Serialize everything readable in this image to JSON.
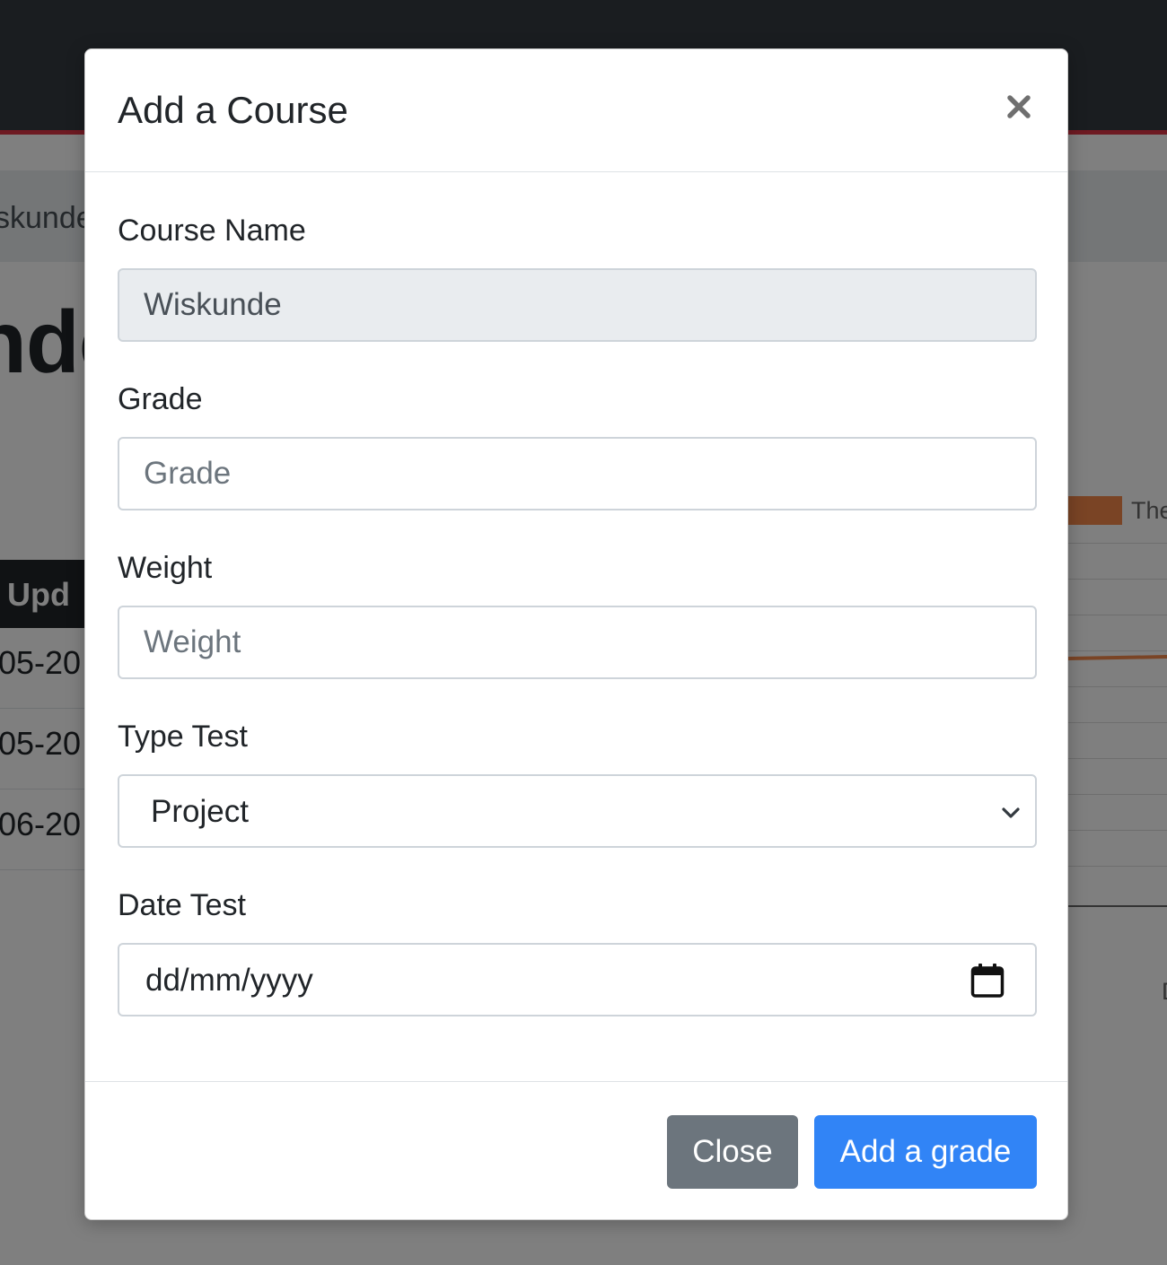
{
  "background": {
    "breadcrumb_fragment": "skunde",
    "heading_fragment": "nde",
    "table_header_fragment": "t Upd",
    "table_rows": [
      "05-20",
      "05-20",
      "06-20"
    ],
    "chart_legend_fragment": "The",
    "chart_axis_fragment": "D"
  },
  "modal": {
    "title": "Add a Course",
    "close_symbol": "×",
    "fields": {
      "course_name": {
        "label": "Course Name",
        "value": "Wiskunde"
      },
      "grade": {
        "label": "Grade",
        "placeholder": "Grade",
        "value": ""
      },
      "weight": {
        "label": "Weight",
        "placeholder": "Weight",
        "value": ""
      },
      "type_test": {
        "label": "Type Test",
        "selected": "Project"
      },
      "date_test": {
        "label": "Date Test",
        "placeholder": "dd/mm/yyyy"
      }
    },
    "footer": {
      "close_label": "Close",
      "submit_label": "Add a grade"
    }
  },
  "colors": {
    "primary": "#3184f6",
    "secondary": "#6c757d",
    "navbar": "#343a40",
    "navbar_accent": "#dc3545",
    "chart_series": "#f5894b"
  },
  "icons": {
    "close": "close-icon",
    "select": "chevron-down-icon",
    "date": "calendar-icon"
  }
}
